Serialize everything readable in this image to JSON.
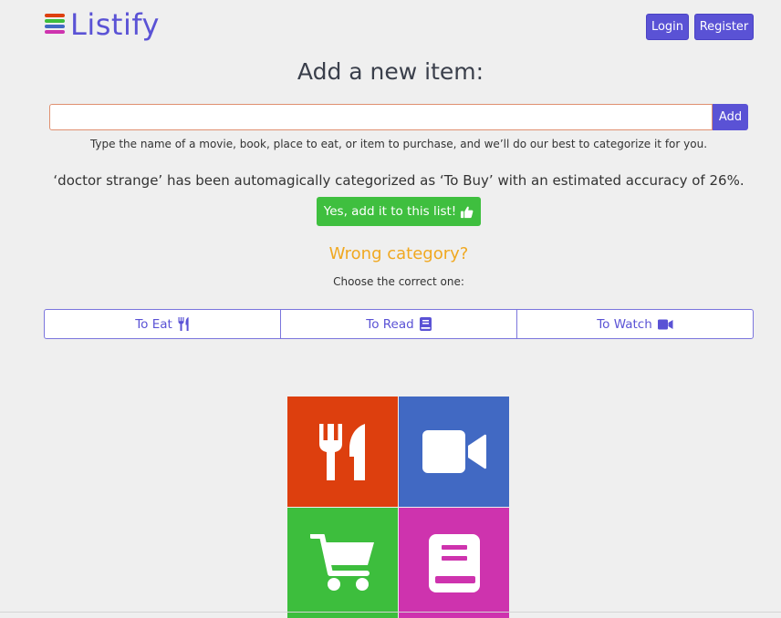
{
  "app": {
    "name": "Listify"
  },
  "header": {
    "login_label": "Login",
    "register_label": "Register"
  },
  "main": {
    "title": "Add a new item:",
    "search": {
      "placeholder": "",
      "value": "",
      "add_label": "Add"
    },
    "hint": "Type the name of a movie, book, place to eat, or item to purchase, and we’ll do our best to categorize it for you.",
    "result_text": "‘doctor strange’ has been automagically categorized as ‘To Buy’ with an estimated accuracy of 26%.",
    "yes_label": "Yes, add it to this list!",
    "wrong_label": "Wrong category?",
    "choose_label": "Choose the correct one:",
    "categories": [
      {
        "label": "To Eat",
        "icon": "utensils-icon"
      },
      {
        "label": "To Read",
        "icon": "book-icon"
      },
      {
        "label": "To Watch",
        "icon": "video-camera-icon"
      }
    ]
  },
  "colors": {
    "accent": "#5a52d5",
    "success": "#3fbf3f",
    "warning": "#f0a820",
    "tile_eat": "#dd3f0e",
    "tile_watch": "#4169c3",
    "tile_buy": "#3dbe3d",
    "tile_read": "#ce33ae"
  }
}
